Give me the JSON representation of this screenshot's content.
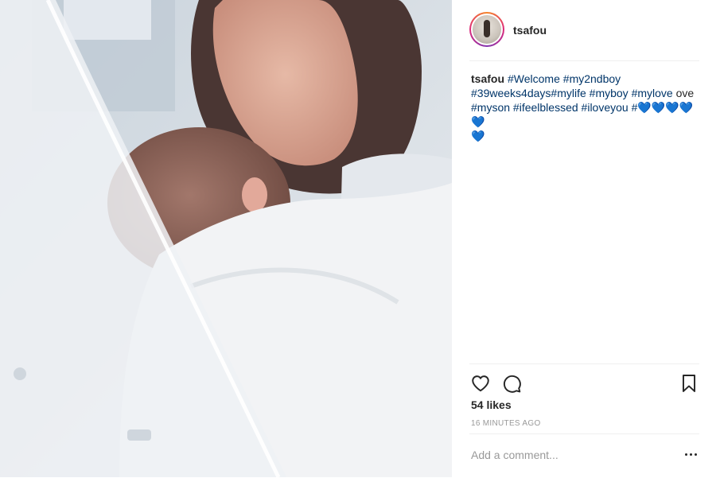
{
  "post": {
    "username": "tsafou",
    "caption": {
      "user": "tsafou",
      "line1_tags": [
        "#Welcome",
        "#my2ndboy"
      ],
      "line2_tags": [
        "#39weeks4days",
        "#mylife",
        "#myboy",
        "#mylove"
      ],
      "line2_text": "ove",
      "line3_tags": [
        "#myson",
        "#ifeelblessed",
        "#iloveyou"
      ],
      "line3_end": "#💙💙💙💙💙",
      "line4": "💙"
    },
    "likes_text": "54 likes",
    "time_text": "16 MINUTES AGO",
    "comment_placeholder": "Add a comment...",
    "icons": {
      "like": "heart-outline-icon",
      "comment": "speech-bubble-icon",
      "save": "bookmark-outline-icon",
      "more": "ellipsis-icon"
    }
  },
  "colors": {
    "hashtag": "#003569",
    "text": "#262626",
    "muted": "#999999",
    "divider": "#efefef"
  }
}
